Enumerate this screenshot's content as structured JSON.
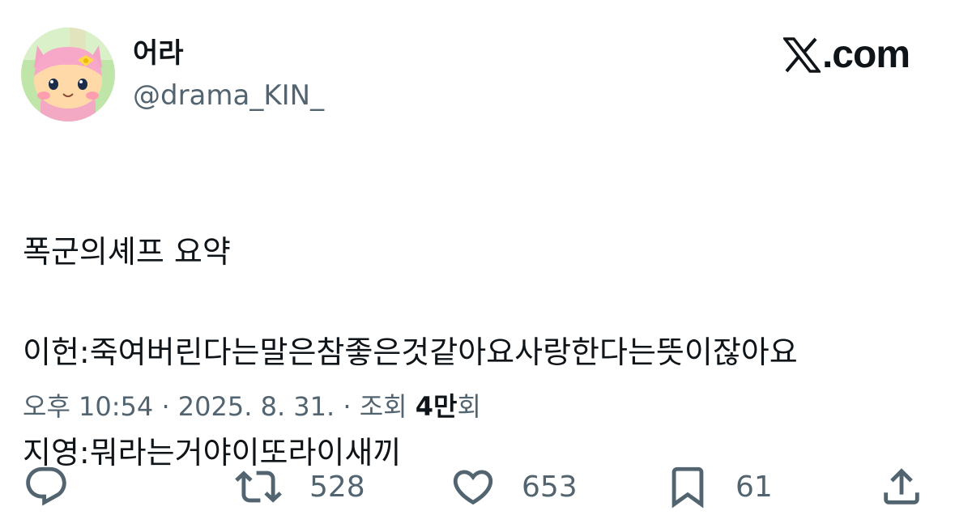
{
  "author": {
    "display_name": "어라",
    "handle": "@drama_KIN_",
    "avatar": "pink-cat-character-avatar"
  },
  "brand": {
    "logo_text": ".com",
    "logo_icon": "x-logo-icon"
  },
  "tweet": {
    "lines": [
      "폭군의셰프 요약",
      "이헌:죽여버린다는말은참좋은것같아요사랑한다는뜻이잖아요",
      "지영:뭐라는거야이또라이새끼"
    ]
  },
  "meta": {
    "time": "오후 10:54",
    "sep1": " · ",
    "date": "2025. 8. 31.",
    "sep2": " · ",
    "views_label": "조회 ",
    "views_count": "4만",
    "views_suffix": "회"
  },
  "actions": {
    "reply": {
      "icon": "reply-icon"
    },
    "retweet": {
      "icon": "retweet-icon",
      "count": "528"
    },
    "like": {
      "icon": "heart-icon",
      "count": "653"
    },
    "bookmark": {
      "icon": "bookmark-icon",
      "count": "61"
    },
    "share": {
      "icon": "share-icon"
    }
  },
  "colors": {
    "text_primary": "#0f1419",
    "text_secondary": "#536471",
    "background": "#ffffff"
  }
}
